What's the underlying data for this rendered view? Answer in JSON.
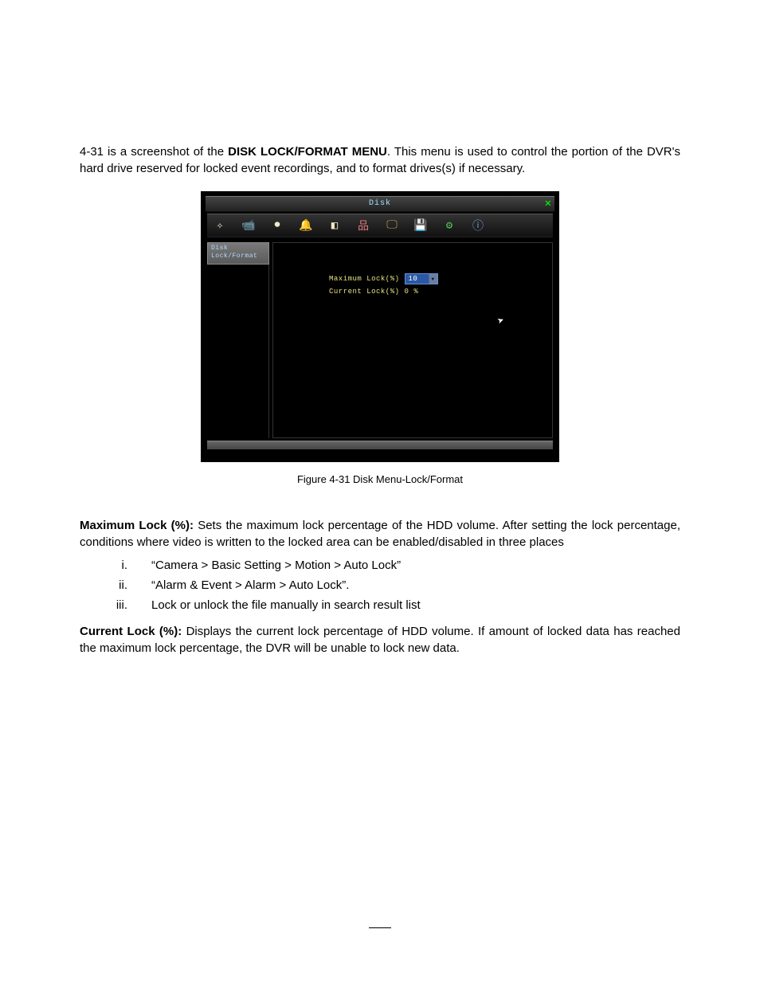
{
  "intro": {
    "prefix": "4-31 is a screenshot of the ",
    "bold": "DISK LOCK/FORMAT MENU",
    "suffix": ". This menu is used to control the portion of the DVR's hard drive reserved for locked event recordings, and to format drives(s) if necessary."
  },
  "dvr": {
    "title": "Disk",
    "close_glyph": "✕",
    "toolbar_icons": [
      {
        "name": "express-icon",
        "glyph": "✧"
      },
      {
        "name": "camera-icon",
        "glyph": "📹"
      },
      {
        "name": "record-icon",
        "glyph": "⏺"
      },
      {
        "name": "alarm-icon",
        "glyph": "🔔"
      },
      {
        "name": "schedule-icon",
        "glyph": "◧"
      },
      {
        "name": "network-icon",
        "glyph": "品"
      },
      {
        "name": "display-icon",
        "glyph": "🖵"
      },
      {
        "name": "disk-icon",
        "glyph": "💾"
      },
      {
        "name": "system-icon",
        "glyph": "⚙"
      },
      {
        "name": "info-icon",
        "glyph": "ⓘ"
      }
    ],
    "side_tab": "Disk\nLock/Format",
    "row1_label": "Maximum Lock(%)",
    "row1_value": "10",
    "row2_label": "Current Lock(%)",
    "row2_value": "0 %"
  },
  "caption": "Figure 4-31 Disk Menu-Lock/Format",
  "max_lock": {
    "heading": "Maximum Lock (%):",
    "text": " Sets the maximum lock percentage of the HDD volume. After setting the lock percentage, conditions where video is written to the locked area can be enabled/disabled in three places"
  },
  "list": [
    {
      "num": "i.",
      "text": "“Camera > Basic Setting > Motion > Auto Lock”"
    },
    {
      "num": "ii.",
      "text": "“Alarm & Event > Alarm > Auto Lock”."
    },
    {
      "num": "iii.",
      "text": "Lock or unlock the file manually in search result list"
    }
  ],
  "cur_lock": {
    "heading": "Current Lock (%):",
    "text": " Displays the current lock percentage of HDD volume. If amount of locked data has reached the maximum lock percentage, the DVR will be unable to lock new data."
  }
}
